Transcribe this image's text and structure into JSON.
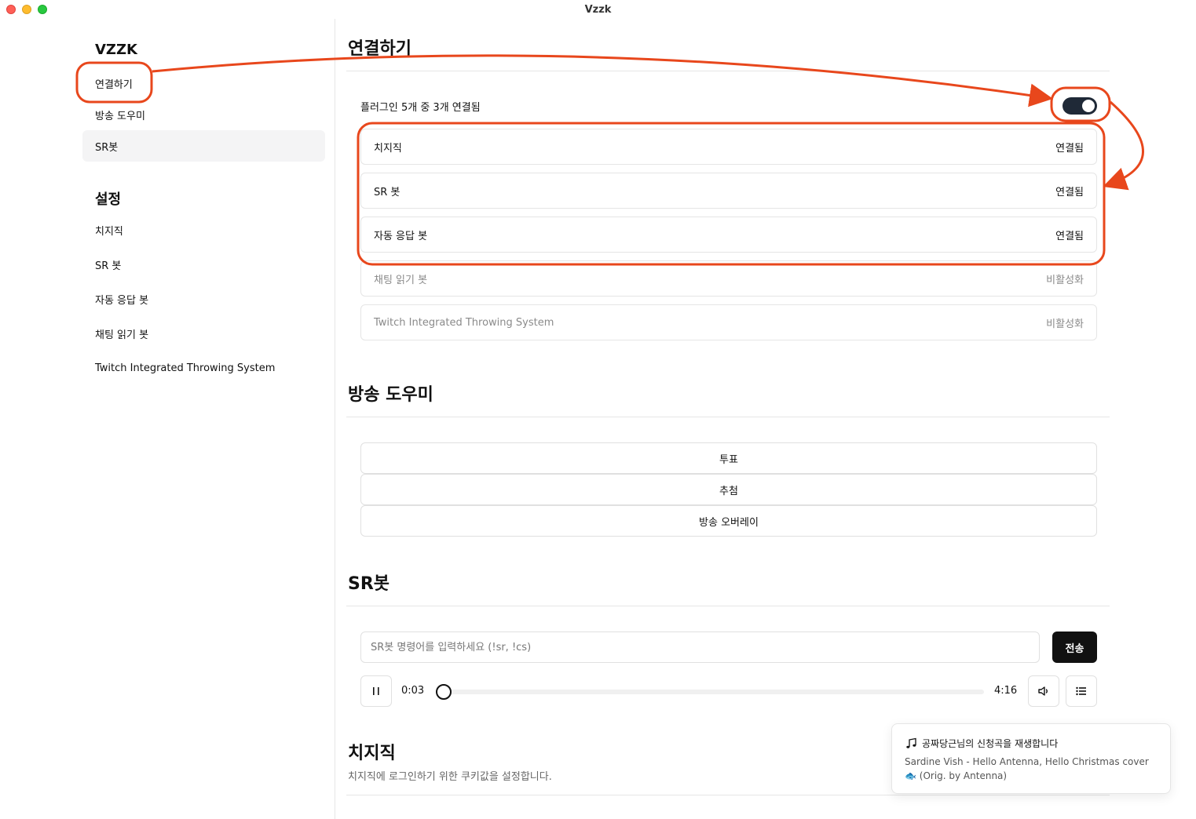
{
  "window": {
    "title": "Vzzk"
  },
  "sidebar": {
    "app_title": "VZZK",
    "items": [
      {
        "label": "연결하기"
      },
      {
        "label": "방송 도우미"
      },
      {
        "label": "SR봇"
      }
    ],
    "settings_title": "설정",
    "settings_items": [
      {
        "label": "치지직"
      },
      {
        "label": "SR 봇"
      },
      {
        "label": "자동 응답 봇"
      },
      {
        "label": "채팅 읽기 봇"
      },
      {
        "label": "Twitch Integrated Throwing System"
      }
    ]
  },
  "connect": {
    "title": "연결하기",
    "summary": "플러그인 5개 중 3개 연결됨",
    "toggle_on": true,
    "plugins": [
      {
        "name": "치지직",
        "status": "연결됨"
      },
      {
        "name": "SR 봇",
        "status": "연결됨"
      },
      {
        "name": "자동 응답 봇",
        "status": "연결됨"
      },
      {
        "name": "채팅 읽기 봇",
        "status": "비활성화"
      },
      {
        "name": "Twitch Integrated Throwing System",
        "status": "비활성화"
      }
    ]
  },
  "broadcast": {
    "title": "방송 도우미",
    "buttons": [
      {
        "label": "투표"
      },
      {
        "label": "추첨"
      },
      {
        "label": "방송 오버레이"
      }
    ]
  },
  "srbot": {
    "title": "SR봇",
    "input_placeholder": "SR봇 명령어를 입력하세요 (!sr, !cs)",
    "send_label": "전송",
    "player": {
      "current_time": "0:03",
      "total_time": "4:16",
      "progress": 0.012
    }
  },
  "chzzk": {
    "title": "치지직",
    "description": "치지직에 로그인하기 위한 쿠키값을 설정합니다."
  },
  "toast": {
    "icon": "music-note-icon",
    "title": "공짜당근님의 신청곡을 재생합니다",
    "body_line1": "Sardine Vish - Hello Antenna, Hello Christmas cover",
    "body_line2": "🐟 (Orig. by Antenna)"
  },
  "colors": {
    "annotation": "#e8471c",
    "primary": "#111111",
    "toggle_bg": "#1f2937"
  }
}
